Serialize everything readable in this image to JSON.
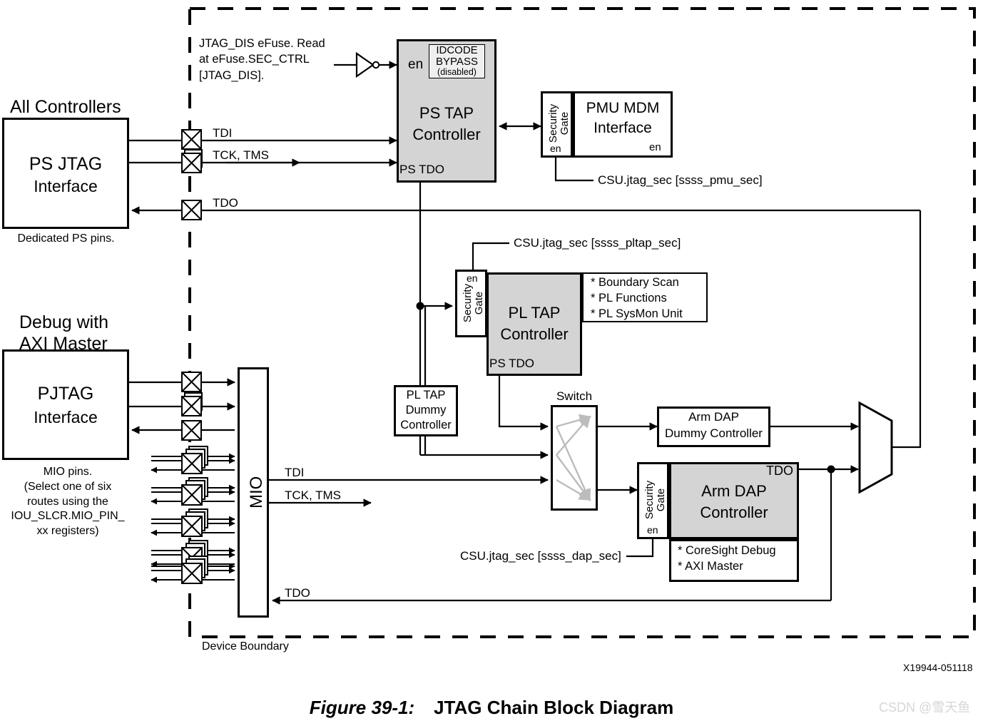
{
  "figure": {
    "number": "Figure 39-1:",
    "title": "JTAG Chain Block Diagram",
    "image_id": "X19944-051118",
    "watermark": "CSDN @雪天鱼"
  },
  "boundary": {
    "label": "Device Boundary"
  },
  "notes": {
    "efuse": "JTAG_DIS eFuse. Read\nat eFuse.SEC_CTRL\n[JTAG_DIS].",
    "dedicated_ps_pins": "Dedicated PS pins.",
    "mio_pins": "MIO pins.\n(Select one of six\nroutes using the\nIOU_SLCR.MIO_PIN_\nxx registers)"
  },
  "left": {
    "all_controllers": "All Controllers",
    "ps_jtag_title": "PS JTAG",
    "ps_jtag_sub": "Interface",
    "debug_with": "Debug with",
    "axi_master": "AXI Master",
    "pjtag_title": "PJTAG",
    "pjtag_sub": "Interface",
    "mio_label": "MIO"
  },
  "signals": {
    "tdi": "TDI",
    "tck_tms": "TCK, TMS",
    "tdo": "TDO",
    "mio_tdi": "TDI",
    "mio_tck_tms": "TCK, TMS",
    "mio_tdo": "TDO",
    "ps_tdo": "PS TDO",
    "dap_tdo": "TDO"
  },
  "ps_tap": {
    "title_line1": "PS TAP",
    "title_line2": "Controller",
    "en": "en",
    "ps_tdo": "PS TDO",
    "idcode": "IDCODE",
    "bypass": "BYPASS",
    "disabled": "(disabled)"
  },
  "pmu": {
    "security_gate": "Security\nGate",
    "en_gate": "en",
    "title_line1": "PMU MDM",
    "title_line2": "Interface",
    "en_block": "en",
    "csu_label": "CSU.jtag_sec [ssss_pmu_sec]"
  },
  "pl_tap": {
    "csu_label": "CSU.jtag_sec [ssss_pltap_sec]",
    "security_gate": "Security\nGate",
    "en_gate": "en",
    "title_line1": "PL TAP",
    "title_line2": "Controller",
    "ps_tdo": "PS TDO",
    "features": [
      "* Boundary Scan",
      "* PL Functions",
      "* PL SysMon Unit"
    ]
  },
  "pl_tap_dummy": {
    "line1": "PL TAP",
    "line2": "Dummy",
    "line3": "Controller"
  },
  "switch": {
    "label": "Switch"
  },
  "arm_dap_dummy": {
    "line1": "Arm DAP",
    "line2": "Dummy Controller"
  },
  "arm_dap": {
    "security_gate": "Security\nGate",
    "en_gate": "en",
    "title_line1": "Arm DAP",
    "title_line2": "Controller",
    "tdo": "TDO",
    "csu_label": "CSU.jtag_sec [ssss_dap_sec]",
    "features": [
      "* CoreSight Debug",
      "* AXI Master"
    ]
  }
}
